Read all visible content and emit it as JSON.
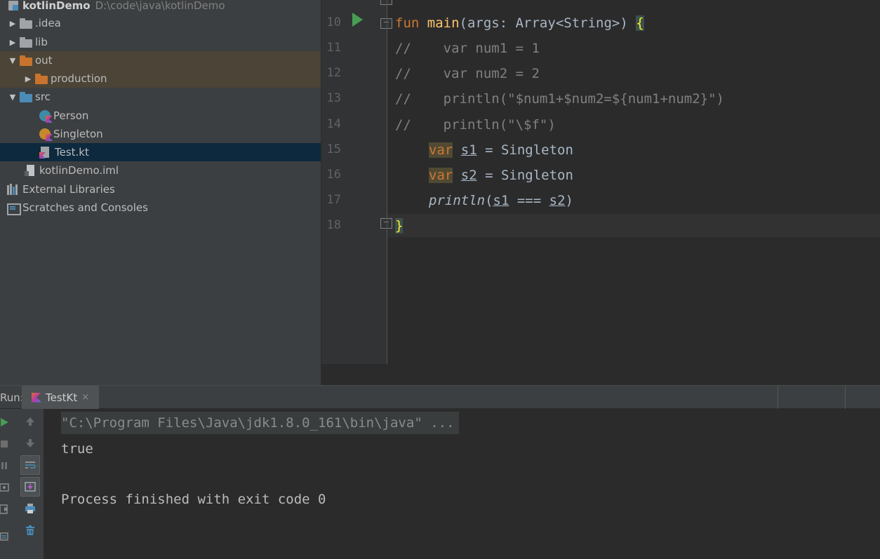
{
  "project_tree": {
    "root": {
      "name": "kotlinDemo",
      "path": "D:\\code\\java\\kotlinDemo"
    },
    "items": [
      {
        "label": ".idea"
      },
      {
        "label": "lib"
      },
      {
        "label": "out"
      },
      {
        "label": "production"
      },
      {
        "label": "src"
      },
      {
        "label": "Person"
      },
      {
        "label": "Singleton"
      },
      {
        "label": "Test.kt"
      },
      {
        "label": "kotlinDemo.iml"
      },
      {
        "label": "External Libraries"
      },
      {
        "label": "Scratches and Consoles"
      }
    ]
  },
  "editor": {
    "line_numbers": [
      "10",
      "11",
      "12",
      "13",
      "14",
      "15",
      "16",
      "17",
      "18"
    ],
    "code": {
      "l10_kw": "fun",
      "l10_fn": "main",
      "l10_rest": "(args: Array<String>) ",
      "l10_brace": "{",
      "l11": "//    var num1 = 1",
      "l12": "//    var num2 = 2",
      "l13": "//    println(\"$num1+$num2=${num1+num2}\")",
      "l14": "//    println(\"\\$f\")",
      "l15_kw": "var",
      "l15_name": "s1",
      "l15_rest": " = Singleton",
      "l16_kw": "var",
      "l16_name": "s2",
      "l16_rest": " = Singleton",
      "l17_fn": "println",
      "l17_open": "(",
      "l17_a": "s1",
      "l17_op": " === ",
      "l17_b": "s2",
      "l17_close": ")",
      "l18_brace": "}"
    }
  },
  "run_panel": {
    "label": "Run:",
    "tab": "TestKt",
    "tab_close": "×",
    "console": [
      "\"C:\\Program Files\\Java\\jdk1.8.0_161\\bin\\java\" ...",
      "true",
      "",
      "Process finished with exit code 0"
    ]
  },
  "colors": {
    "keyword": "#cc7832",
    "function": "#ffc66d",
    "comment": "#808080",
    "run_green": "#499c54",
    "selection": "#0d293e"
  }
}
